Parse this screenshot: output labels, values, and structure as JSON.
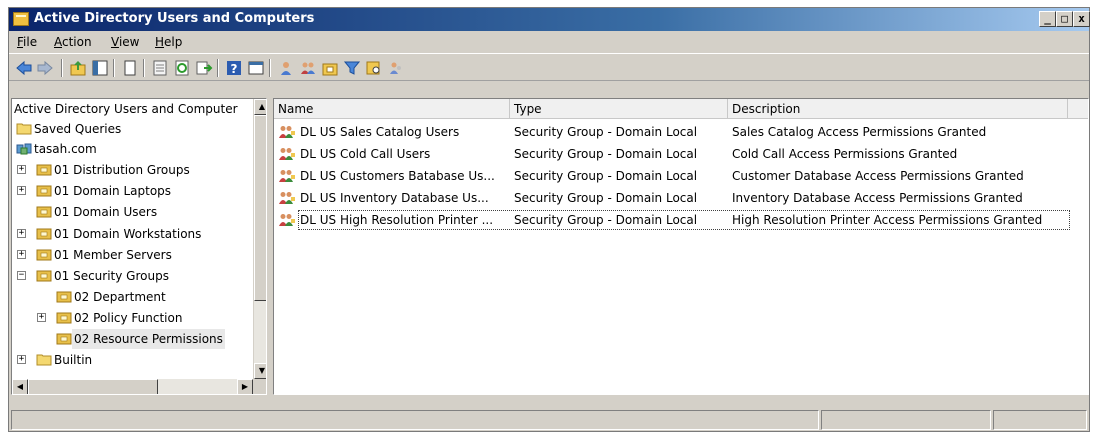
{
  "window": {
    "title": "Active Directory Users and Computers",
    "controls": {
      "minimize": "_",
      "maximize": "□",
      "close": "x"
    }
  },
  "menu": {
    "items": [
      {
        "label": "File",
        "accel": "F"
      },
      {
        "label": "Action",
        "accel": "A"
      },
      {
        "label": "View",
        "accel": "V"
      },
      {
        "label": "Help",
        "accel": "H"
      }
    ]
  },
  "toolbar": {
    "buttons": [
      "back-icon",
      "forward-icon",
      "up-folder-icon",
      "show-tree-icon",
      "copy-icon",
      "properties-icon",
      "refresh-icon",
      "export-list-icon",
      "help-icon",
      "show-console-icon",
      "new-user-icon",
      "new-group-icon",
      "new-ou-icon",
      "filter-icon",
      "find-icon",
      "add-to-group-icon"
    ]
  },
  "tree": {
    "items": [
      {
        "label": "Active Directory Users and Computer",
        "expander": "",
        "icon": "directory-root-icon"
      },
      {
        "label": "Saved Queries",
        "expander": "",
        "icon": "folder-icon"
      },
      {
        "label": "tasah.com",
        "expander": "",
        "icon": "domain-icon"
      },
      {
        "label": "01 Distribution Groups",
        "expander": "+",
        "icon": "ou-folder-icon"
      },
      {
        "label": "01 Domain Laptops",
        "expander": "+",
        "icon": "ou-folder-icon"
      },
      {
        "label": "01 Domain Users",
        "expander": "",
        "icon": "ou-folder-icon"
      },
      {
        "label": "01 Domain Workstations",
        "expander": "+",
        "icon": "ou-folder-icon"
      },
      {
        "label": "01 Member Servers",
        "expander": "+",
        "icon": "ou-folder-icon"
      },
      {
        "label": "01 Security Groups",
        "expander": "−",
        "icon": "ou-folder-icon"
      },
      {
        "label": "02 Department",
        "expander": "",
        "icon": "ou-folder-icon"
      },
      {
        "label": "02 Policy Function",
        "expander": "+",
        "icon": "ou-folder-icon"
      },
      {
        "label": "02 Resource Permissions",
        "expander": "",
        "icon": "ou-folder-icon",
        "selected": true
      },
      {
        "label": "Builtin",
        "expander": "+",
        "icon": "folder-icon"
      }
    ]
  },
  "list": {
    "columns": [
      "Name",
      "Type",
      "Description"
    ],
    "rows": [
      {
        "name": "DL US Sales Catalog Users",
        "type": "Security Group - Domain Local",
        "description": "Sales Catalog Access Permissions Granted"
      },
      {
        "name": "DL US Cold Call Users",
        "type": "Security Group - Domain Local",
        "description": "Cold Call Access Permissions Granted"
      },
      {
        "name": "DL US Customers Batabase Us...",
        "type": "Security Group - Domain Local",
        "description": "Customer Database Access Permissions Granted"
      },
      {
        "name": "DL US Inventory Database Us...",
        "type": "Security Group - Domain Local",
        "description": "Inventory Database Access Permissions Granted"
      },
      {
        "name": "DL US High Resolution Printer ...",
        "type": "Security Group - Domain Local",
        "description": "High Resolution Printer Access Permissions Granted",
        "focused": true
      }
    ]
  },
  "colors": {
    "titlebar_start": "#0a246a",
    "titlebar_end": "#a6caf0",
    "chrome": "#d4d0c8",
    "folder": "#e8c04a"
  }
}
